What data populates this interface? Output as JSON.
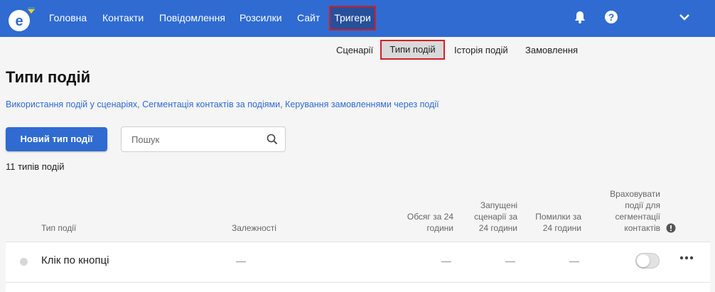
{
  "nav": {
    "items": [
      "Головна",
      "Контакти",
      "Повідомлення",
      "Розсилки",
      "Сайт"
    ],
    "active": "Тригери"
  },
  "subnav": {
    "items": [
      "Сценарії",
      "Історія подій",
      "Замовлення"
    ],
    "active": "Типи подій"
  },
  "page": {
    "title": "Типи подій",
    "links": [
      "Використання подій у сценаріях",
      "Сегментація контактів за подіями",
      "Керування замовленнями через події"
    ],
    "new_button": "Новий тип події",
    "search_placeholder": "Пошук",
    "count": "11 типів подій"
  },
  "table": {
    "headers": {
      "type": "Тип події",
      "deps": "Залежності",
      "volume": [
        "Обсяг за 24",
        "години"
      ],
      "scenarios": [
        "Запущені",
        "сценарії за",
        "24 години"
      ],
      "errors": [
        "Помилки за",
        "24 години"
      ],
      "segmentation": [
        "Враховувати",
        "події для",
        "сегментації",
        "контактів"
      ]
    },
    "rows": [
      {
        "name": "Клік по кнопці",
        "deps": "—",
        "volume": "—",
        "scenarios": "—",
        "errors": "—"
      }
    ]
  },
  "colors": {
    "brand": "#2f6bd1",
    "highlight": "#d0202a"
  }
}
